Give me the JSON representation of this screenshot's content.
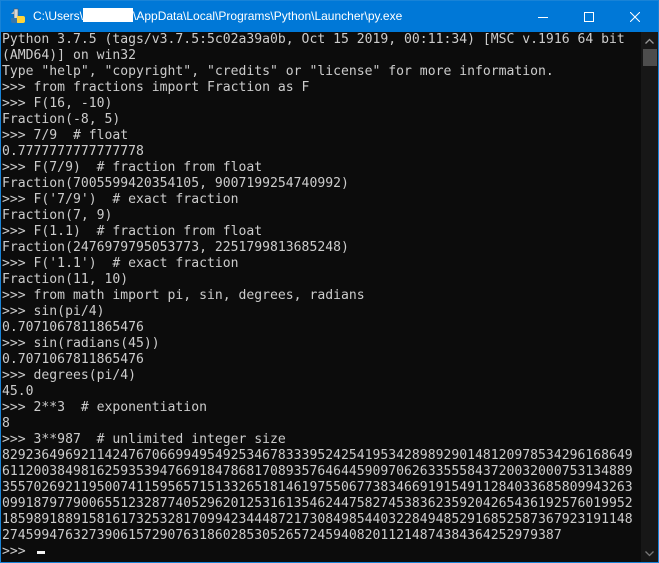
{
  "window": {
    "title_prefix": "C:\\Users\\",
    "title_suffix": "\\AppData\\Local\\Programs\\Python\\Launcher\\py.exe",
    "title_redacted": true,
    "controls": {
      "minimize": "minimize",
      "maximize": "maximize",
      "close": "close"
    },
    "accent_color": "#0078d7"
  },
  "console": {
    "lines": [
      "Python 3.7.5 (tags/v3.7.5:5c02a39a0b, Oct 15 2019, 00:11:34) [MSC v.1916 64 bit",
      "(AMD64)] on win32",
      "Type \"help\", \"copyright\", \"credits\" or \"license\" for more information.",
      ">>> from fractions import Fraction as F",
      ">>> F(16, -10)",
      "Fraction(-8, 5)",
      ">>> 7/9  # float",
      "0.7777777777777778",
      ">>> F(7/9)  # fraction from float",
      "Fraction(7005599420354105, 9007199254740992)",
      ">>> F('7/9')  # exact fraction",
      "Fraction(7, 9)",
      ">>> F(1.1)  # fraction from float",
      "Fraction(2476979795053773, 2251799813685248)",
      ">>> F('1.1')  # exact fraction",
      "Fraction(11, 10)",
      ">>> from math import pi, sin, degrees, radians",
      ">>> sin(pi/4)",
      "0.7071067811865476",
      ">>> sin(radians(45))",
      "0.7071067811865476",
      ">>> degrees(pi/4)",
      "45.0",
      ">>> 2**3  # exponentiation",
      "8",
      ">>> 3**987  # unlimited integer size",
      "82923649692114247670669949549253467833395242541953428989290148120978534296168649",
      "61120038498162593539476691847868170893576464459097062633555843720032000753134889",
      "35570269211950074115956571513326518146197550677383466919154911284033685809943263",
      "09918797790065512328774052962012531613546244758274538362359204265436192576019952",
      "18598918891581617325328170994234448721730849854403228494852916852587367923191148",
      "27459947632739061572907631860285305265724594082011214874384364252979387"
    ],
    "prompt": ">>> "
  },
  "scrollbar": {
    "up": "scroll-up",
    "down": "scroll-down"
  }
}
